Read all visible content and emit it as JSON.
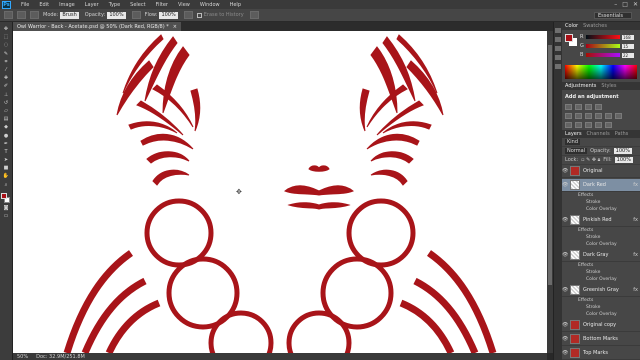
{
  "app": {
    "logo": "Ps",
    "window_controls": [
      "–",
      "□",
      "✕"
    ]
  },
  "menu": [
    "File",
    "Edit",
    "Image",
    "Layer",
    "Type",
    "Select",
    "Filter",
    "View",
    "Window",
    "Help"
  ],
  "options": {
    "mode_label": "Mode:",
    "mode_value": "Brush",
    "opacity_label": "Opacity:",
    "opacity_value": "100%",
    "flow_label": "Flow:",
    "flow_value": "100%",
    "erase_history_label": "Erase to History",
    "workspace": "Essentials"
  },
  "document": {
    "tab_title": "Owl Warrior - Back - Acetate.psd @ 50% (Dark Red, RGB/8) *",
    "close": "×"
  },
  "status": {
    "zoom": "50%",
    "doc_info": "Doc: 32.9M/251.8M"
  },
  "colors": {
    "foreground": "#a80f16",
    "background": "#ffffff",
    "art": "#a81419"
  },
  "color_panel": {
    "tabs": [
      "Color",
      "Swatches"
    ],
    "sliders": [
      {
        "label": "R",
        "value": "168"
      },
      {
        "label": "G",
        "value": "15"
      },
      {
        "label": "B",
        "value": "22"
      }
    ]
  },
  "adjustments": {
    "tabs": [
      "Adjustments",
      "Styles"
    ],
    "title": "Add an adjustment"
  },
  "layers_panel": {
    "tabs": [
      "Layers",
      "Channels",
      "Paths"
    ],
    "kind_label": "Kind",
    "blend_mode": "Normal",
    "opacity_label": "Opacity:",
    "opacity_value": "100%",
    "lock_label": "Lock:",
    "fill_label": "Fill:",
    "fill_value": "100%",
    "layers": [
      {
        "name": "Original",
        "fx": "",
        "thumb": "red",
        "selected": false
      },
      {
        "name": "Dark Red",
        "fx": "fx",
        "thumb": "check",
        "selected": true
      },
      {
        "name": "Pinkish Red",
        "fx": "fx",
        "thumb": "check",
        "selected": false
      },
      {
        "name": "Dark Gray",
        "fx": "fx",
        "thumb": "check",
        "selected": false
      },
      {
        "name": "Greenish Gray",
        "fx": "fx",
        "thumb": "check",
        "selected": false
      },
      {
        "name": "Original copy",
        "fx": "",
        "thumb": "red",
        "selected": false
      },
      {
        "name": "Bottom Marks",
        "fx": "",
        "thumb": "red",
        "selected": false
      },
      {
        "name": "Top Marks",
        "fx": "",
        "thumb": "red",
        "selected": false
      }
    ],
    "effects_label": "Effects",
    "stroke_label": "Stroke",
    "overlay_label": "Color Overlay"
  }
}
